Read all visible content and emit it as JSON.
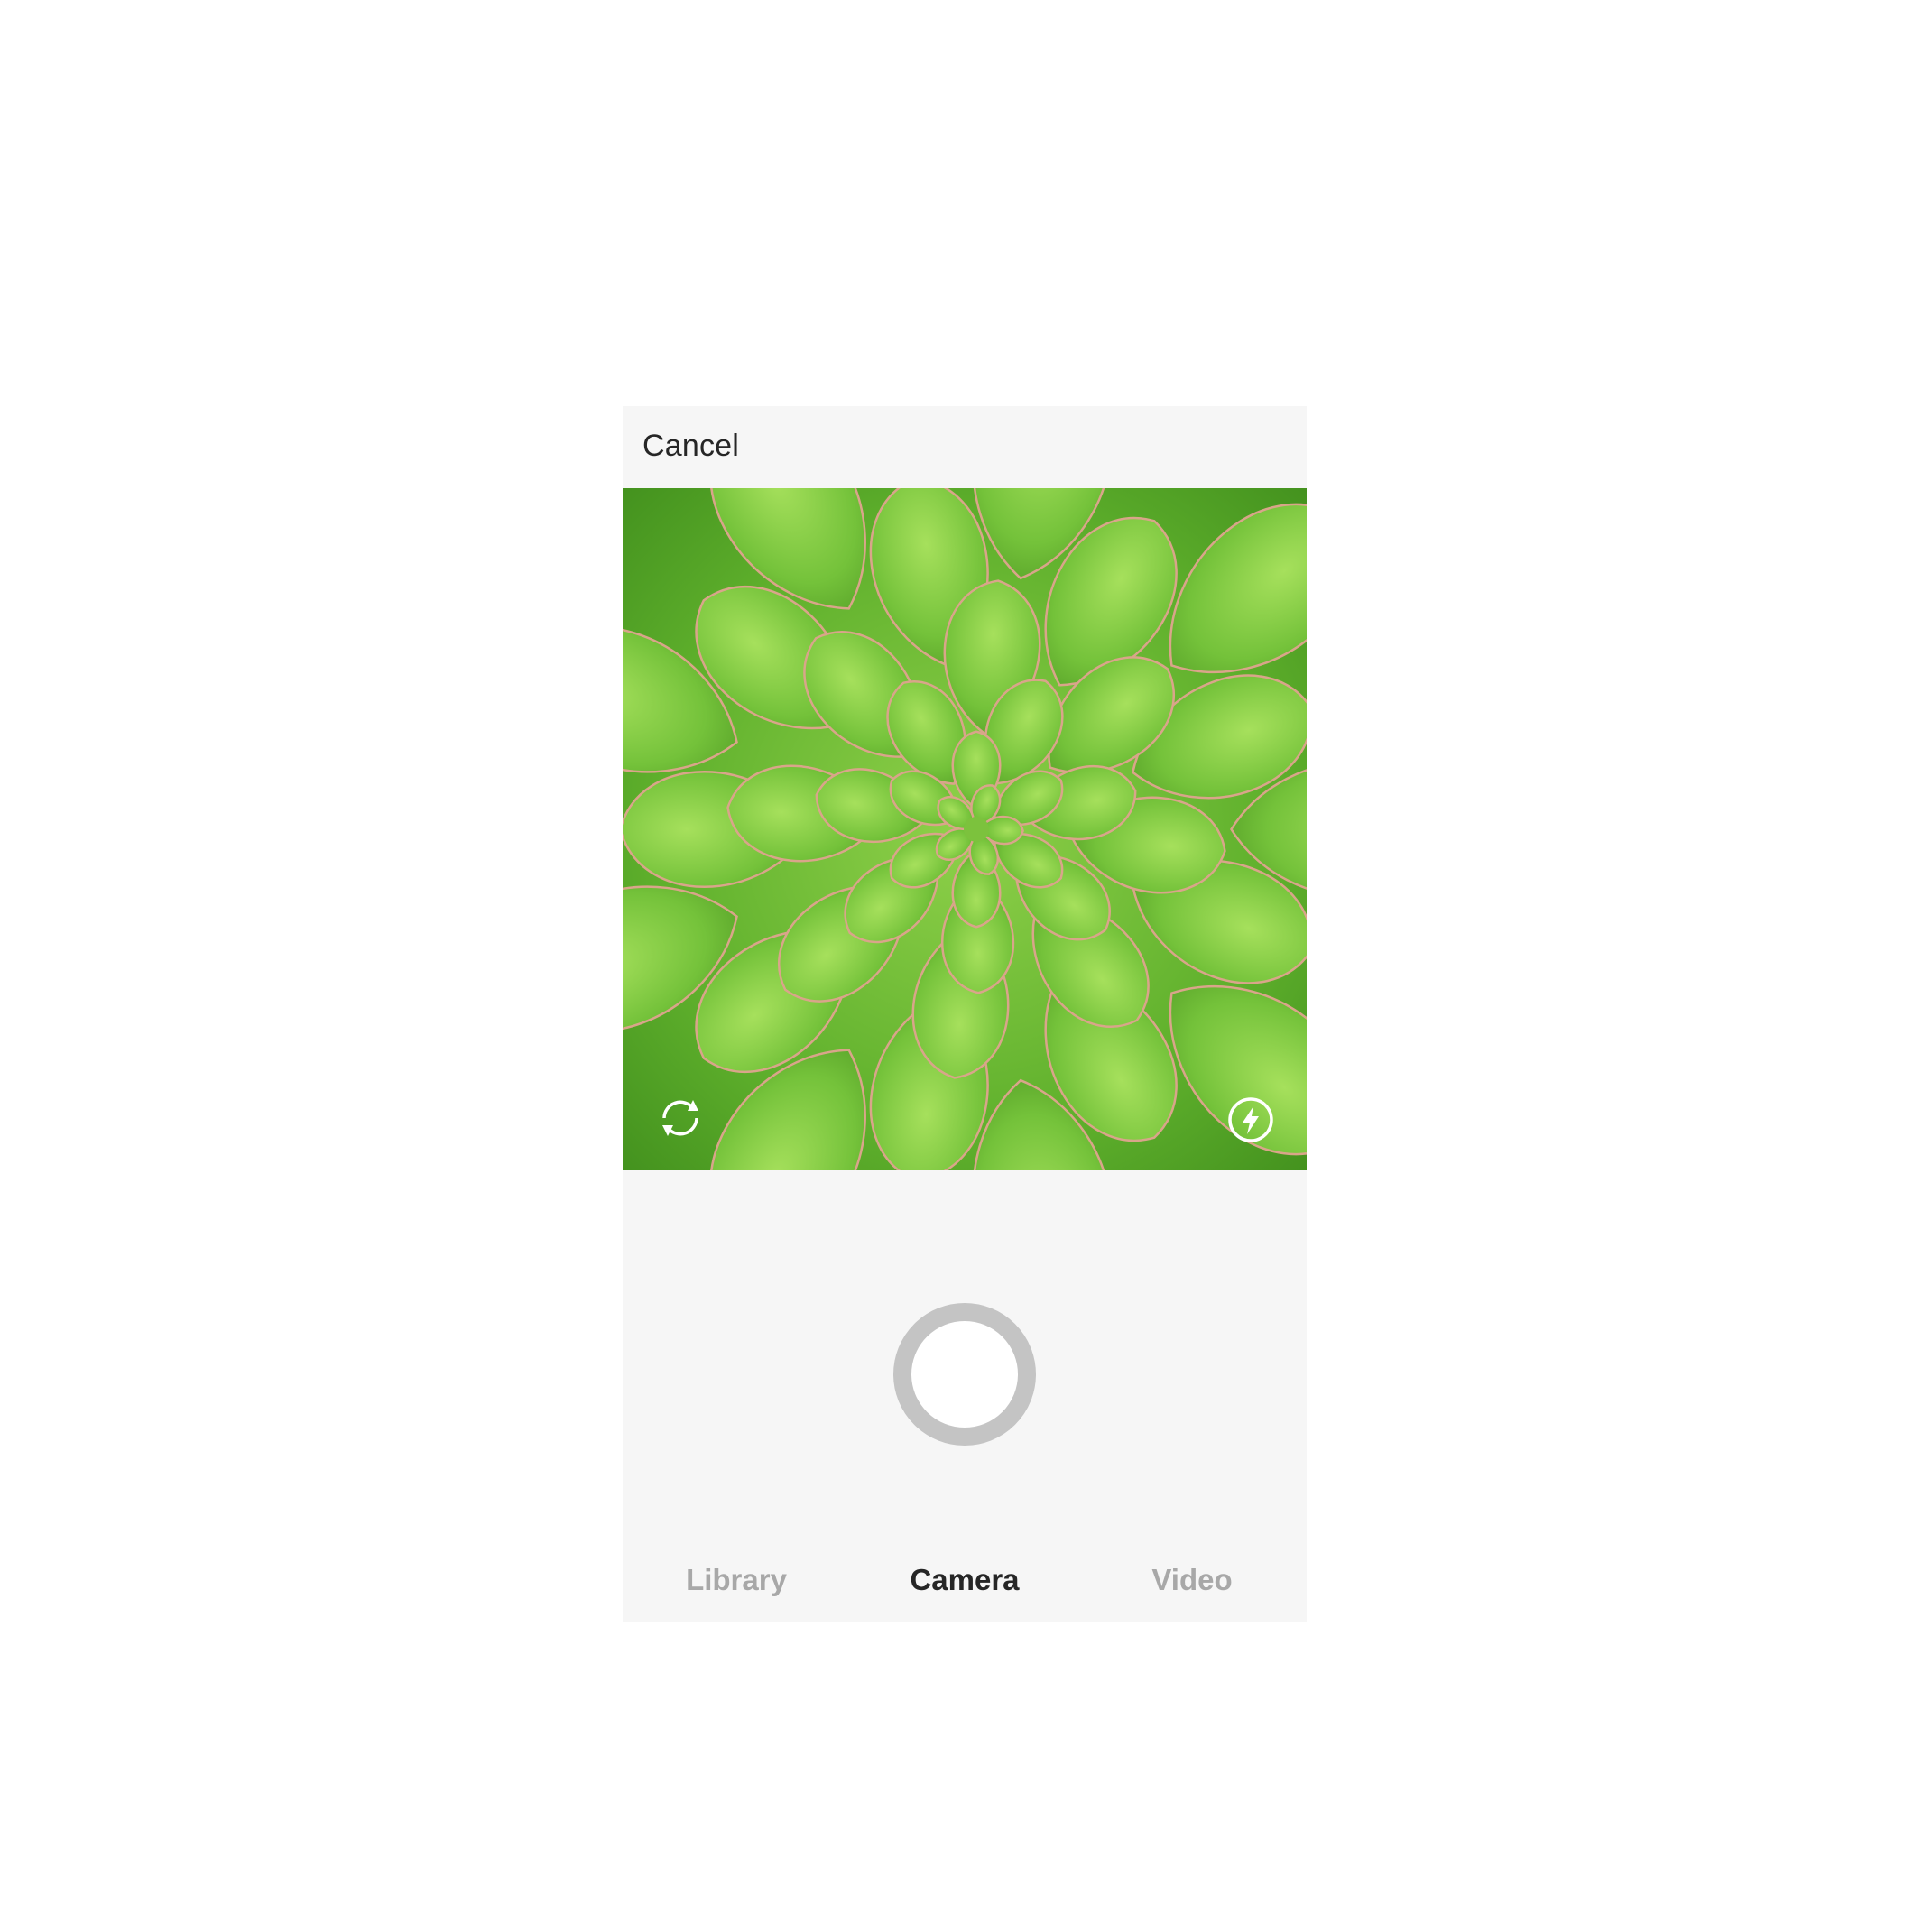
{
  "header": {
    "cancel_label": "Cancel"
  },
  "camera": {
    "switch_camera_icon": "camera-flip-icon",
    "flash_icon": "flash-icon",
    "shutter_icon": "shutter-button"
  },
  "tabs": [
    {
      "label": "Library",
      "active": false
    },
    {
      "label": "Camera",
      "active": true
    },
    {
      "label": "Video",
      "active": false
    }
  ],
  "colors": {
    "background": "#f6f6f6",
    "active_tab": "#262626",
    "inactive_tab": "#a8a8a8",
    "shutter_ring": "#c4c4c4"
  }
}
